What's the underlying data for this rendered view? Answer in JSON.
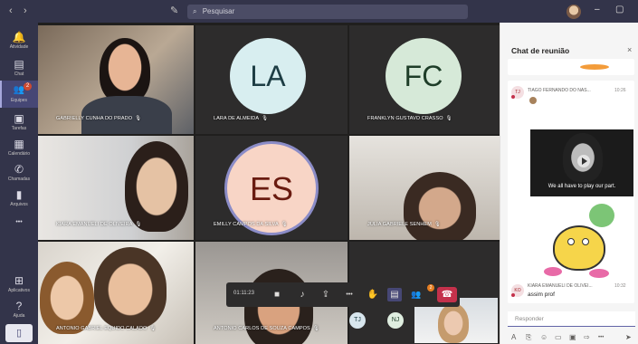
{
  "titlebar": {
    "search_placeholder": "Pesquisar",
    "back_glyph": "‹",
    "forward_glyph": "›",
    "compose_glyph": "✎",
    "search_glyph": "⌕",
    "minimize_glyph": "–",
    "maximize_glyph": "▢"
  },
  "rail": {
    "items": [
      {
        "label": "Atividade",
        "icon": "bell-icon",
        "glyph": "🔔"
      },
      {
        "label": "Chat",
        "icon": "chat-icon",
        "glyph": "▤"
      },
      {
        "label": "Equipes",
        "icon": "teams-icon",
        "glyph": "👥",
        "badge": "2"
      },
      {
        "label": "Tarefas",
        "icon": "assignments-icon",
        "glyph": "▣"
      },
      {
        "label": "Calendário",
        "icon": "calendar-icon",
        "glyph": "▦"
      },
      {
        "label": "Chamadas",
        "icon": "phone-icon",
        "glyph": "✆"
      },
      {
        "label": "Arquivos",
        "icon": "files-icon",
        "glyph": "▮"
      },
      {
        "label": "",
        "icon": "more-icon",
        "glyph": "•••"
      },
      {
        "label": "Aplicativos",
        "icon": "apps-icon",
        "glyph": "⊞"
      },
      {
        "label": "Ajuda",
        "icon": "help-icon",
        "glyph": "?"
      }
    ],
    "device_glyph": "▯"
  },
  "participants": [
    {
      "name": "GABRIELLY CUNHA DO PRADO",
      "type": "video"
    },
    {
      "name": "LARA DE ALMEIDA",
      "initials": "LA",
      "type": "avatar",
      "bg": "#d8eef0",
      "fg": "#1d3d44"
    },
    {
      "name": "FRANKLYN GUSTAVO CRASSO",
      "initials": "FC",
      "type": "avatar",
      "bg": "#d6e9d8",
      "fg": "#1e3d28"
    },
    {
      "name": "KIARA EMANUELI DE OLIVEIRA",
      "type": "video"
    },
    {
      "name": "EMILLY CAMPOS DA SILVA",
      "initials": "ES",
      "type": "avatar",
      "bg": "#f8d5c6",
      "fg": "#6a1b10"
    },
    {
      "name": "JULIA GABRIELE SENHEM",
      "type": "video"
    },
    {
      "name": "ANTONIO GABRIEL EQUIDO CALADO",
      "type": "video"
    },
    {
      "name": "ANTONIO CARLOS DE SOUZA CAMPOS",
      "type": "video"
    },
    {
      "name": "TJ",
      "initials": "TJ",
      "type": "small",
      "bg": "#d8e6ee"
    },
    {
      "name": "NJ",
      "initials": "NJ",
      "type": "small",
      "bg": "#dfeee0"
    }
  ],
  "mic_glyph": "🎙",
  "controls": {
    "timer": "01:11:23",
    "video_glyph": "■",
    "mic_glyph": "♪",
    "share_glyph": "⇪",
    "more_glyph": "•••",
    "hand_glyph": "✋",
    "chat_glyph": "▤",
    "people_glyph": "👥",
    "people_badge": "2",
    "hangup_glyph": "☎"
  },
  "chat": {
    "title": "Chat de reunião",
    "close_glyph": "×",
    "messages": [
      {
        "initials": "TJ",
        "author": "TIAGO FERNANDO DO NAS...",
        "time": "10:26",
        "caption": "We all have to play our part."
      },
      {
        "initials": "KO",
        "author": "KIARA EMANUELI DE OLIVEI...",
        "time": "10:32",
        "text": "assim prof"
      }
    ],
    "compose_placeholder": "Responder",
    "tools": [
      "A",
      "⎘",
      "☺",
      "▭",
      "▣",
      "⇨",
      "•••",
      "➤"
    ]
  }
}
